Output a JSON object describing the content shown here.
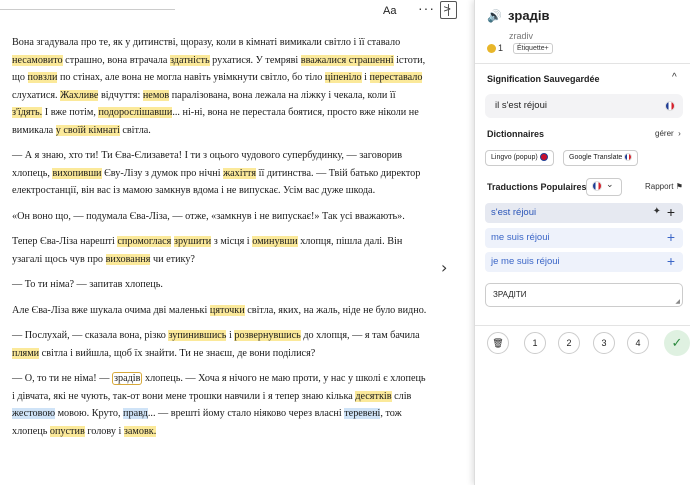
{
  "toolbar": {
    "aa": "Aa",
    "menu": "···",
    "panel_chevron": ">"
  },
  "reader": {
    "p1": [
      {
        "t": "Вона згадувала про те, як у дитинстві, щоразу, коли в кімнаті вимикали світло і її ставало "
      },
      {
        "t": "несамовито",
        "h": "y"
      },
      {
        "t": " страшно, вона втрачала "
      },
      {
        "t": "здатність",
        "h": "y"
      },
      {
        "t": " рухатися.  У темряві "
      },
      {
        "t": "вважалися страшенні",
        "h": "y"
      },
      {
        "t": " істоти, що "
      },
      {
        "t": "повзли",
        "h": "y"
      },
      {
        "t": " по стінах, але вона не могла навіть увімкнути світло, бо тіло "
      },
      {
        "t": "ціпеніло",
        "h": "y"
      },
      {
        "t": " і "
      },
      {
        "t": "переставало",
        "h": "y"
      },
      {
        "t": " слухатися.  "
      },
      {
        "t": "Жахливе",
        "h": "y"
      },
      {
        "t": " відчуття: "
      },
      {
        "t": "немов",
        "h": "y"
      },
      {
        "t": " паралізована, вона лежала на ліжку і чекала, коли її "
      },
      {
        "t": "з'їдять.",
        "h": "y"
      },
      {
        "t": "  І вже потім, "
      },
      {
        "t": "подорослішавши",
        "h": "y"
      },
      {
        "t": "... ні-ні, вона не перестала боятися, просто вже ніколи не вимикала "
      },
      {
        "t": "у своїй кімнаті",
        "h": "y"
      },
      {
        "t": " світла."
      }
    ],
    "p2": [
      {
        "t": "— А я знаю, хто ти!  Ти Єва-Єлизавета!  І ти з оцього чудового супербудинку, — заговорив хлопець, "
      },
      {
        "t": "вихопивши",
        "h": "y"
      },
      {
        "t": " Єву-Лізу з думок про нічні "
      },
      {
        "t": "жахіття",
        "h": "y"
      },
      {
        "t": " її дитинства.  — Твій батько директор електростанції, він вас із мамою замкнув вдома і не випускає.  Усім вас дуже шкода."
      }
    ],
    "p3": [
      {
        "t": "«Он воно що, — подумала Єва-Ліза, — отже, «замкнув і не випускає!» Так усі вважають»."
      }
    ],
    "p4": [
      {
        "t": "Тепер Єва-Ліза нарешті "
      },
      {
        "t": "спромоглася",
        "h": "y"
      },
      {
        "t": " "
      },
      {
        "t": "зрушити",
        "h": "y"
      },
      {
        "t": " з місця і "
      },
      {
        "t": "оминувши",
        "h": "y"
      },
      {
        "t": " хлопця, пішла далі.  Він узагалі щось чув про "
      },
      {
        "t": "виховання",
        "h": "y"
      },
      {
        "t": " чи етику?"
      }
    ],
    "p5": [
      {
        "t": "— То ти німа?  — запитав хлопець."
      }
    ],
    "p6": [
      {
        "t": "Але Єва-Ліза вже шукала очима дві маленькі "
      },
      {
        "t": "цяточки",
        "h": "y"
      },
      {
        "t": " світла, яких, на жаль, ніде не було видно."
      }
    ],
    "p7": [
      {
        "t": "— Послухай, — сказала вона, різко "
      },
      {
        "t": "зупинившись",
        "h": "y"
      },
      {
        "t": " і "
      },
      {
        "t": "розвернувшись",
        "h": "y"
      },
      {
        "t": " до хлопця, — я там бачила "
      },
      {
        "t": "плями",
        "h": "y"
      },
      {
        "t": " світла і вийшла, щоб їх знайти.  Ти не знаєш, де вони поділися?"
      }
    ],
    "p8": [
      {
        "t": "— О, то ти не німа!  — "
      },
      {
        "t": "зрадів",
        "h": "box"
      },
      {
        "t": " хлопець.  — Хоча я нічого не маю проти, у нас у школі є хлопець і дівчата, які не чують, так-от вони мене трошки навчили і я тепер знаю кілька "
      },
      {
        "t": "десятків",
        "h": "y"
      },
      {
        "t": " слів "
      },
      {
        "t": "жестовою",
        "h": "b"
      },
      {
        "t": " мовою.  Круто, "
      },
      {
        "t": "правд",
        "h": "b"
      },
      {
        "t": "... — вреш­ті йому стало ніяково через власні "
      },
      {
        "t": "теревені",
        "h": "b"
      },
      {
        "t": ", тож хлопець "
      },
      {
        "t": "опустив",
        "h": "y"
      },
      {
        "t": " голову і "
      },
      {
        "t": "замовк.",
        "h": "y"
      }
    ]
  },
  "sidebar": {
    "word": "зрадів",
    "transliteration": "zradiv",
    "coins": "1",
    "tag_label": "Étiquette+",
    "saved_title": "Signification Sauvegardée",
    "saved_value": "il s'est réjoui",
    "dict_title": "Dictionnaires",
    "dict_manage": "gérer",
    "dict_chips": [
      "Lingvo (popup)",
      "Google Translate"
    ],
    "popular_title": "Traductions Populaires",
    "report_label": "Rapport",
    "translations": [
      "s'est réjoui",
      "me suis réjoui",
      "je me suis réjoui"
    ],
    "custom_value": "ЗРАДІТИ",
    "levels": [
      "1",
      "2",
      "3",
      "4"
    ],
    "colors": {
      "accent_blue": "#3b66c7",
      "highlight_yellow": "#fbe99a",
      "highlight_blue": "#cfe3f7",
      "known_green": "#2b8a3e"
    }
  }
}
